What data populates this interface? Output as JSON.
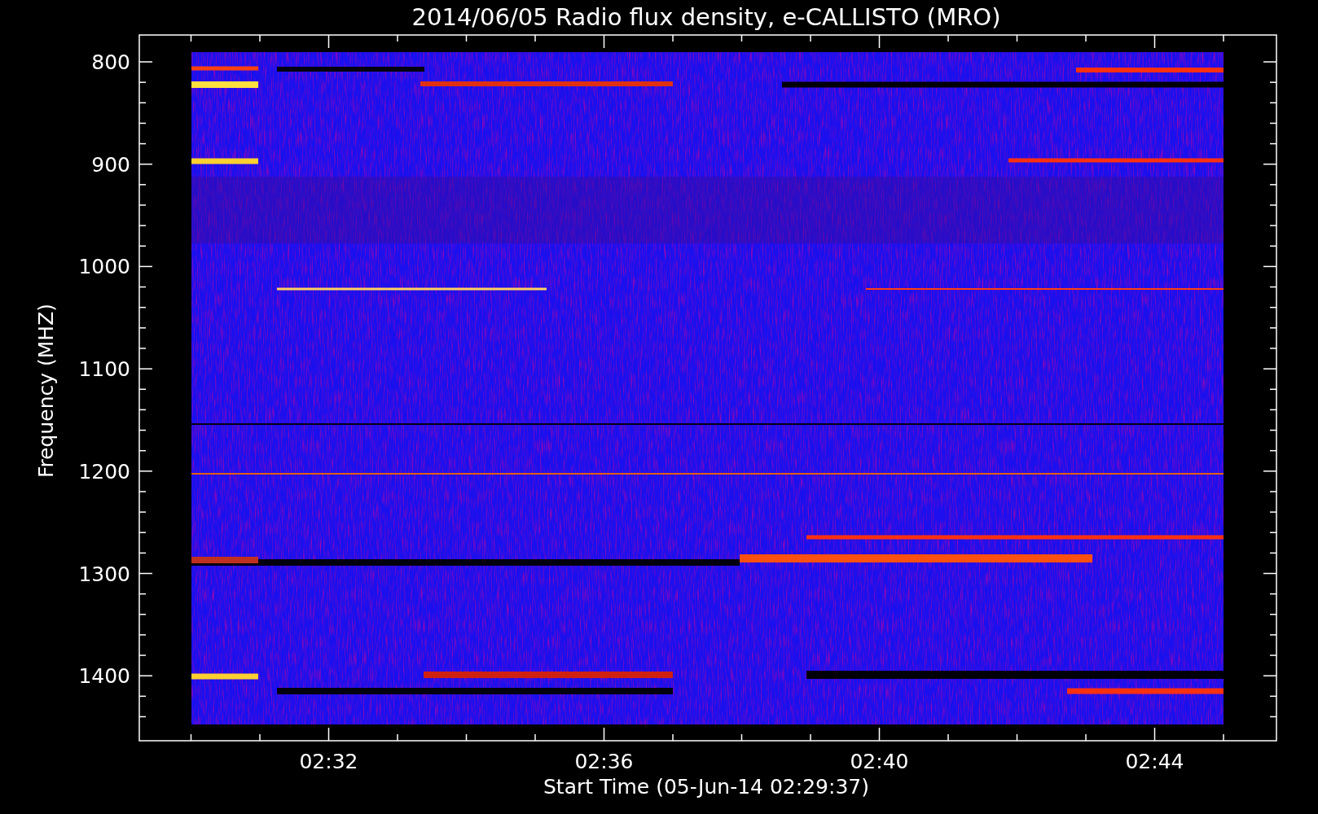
{
  "title": "2014/06/05  Radio flux density, e-CALLISTO (MRO)",
  "y_axis": {
    "label": "Frequency (MHZ)",
    "ticks": [
      "800",
      "900",
      "1000",
      "1100",
      "1200",
      "1300",
      "1400"
    ]
  },
  "x_axis": {
    "label": "Start Time (05-Jun-14 02:29:37)",
    "ticks": [
      "02:32",
      "02:36",
      "02:40",
      "02:44"
    ]
  }
}
